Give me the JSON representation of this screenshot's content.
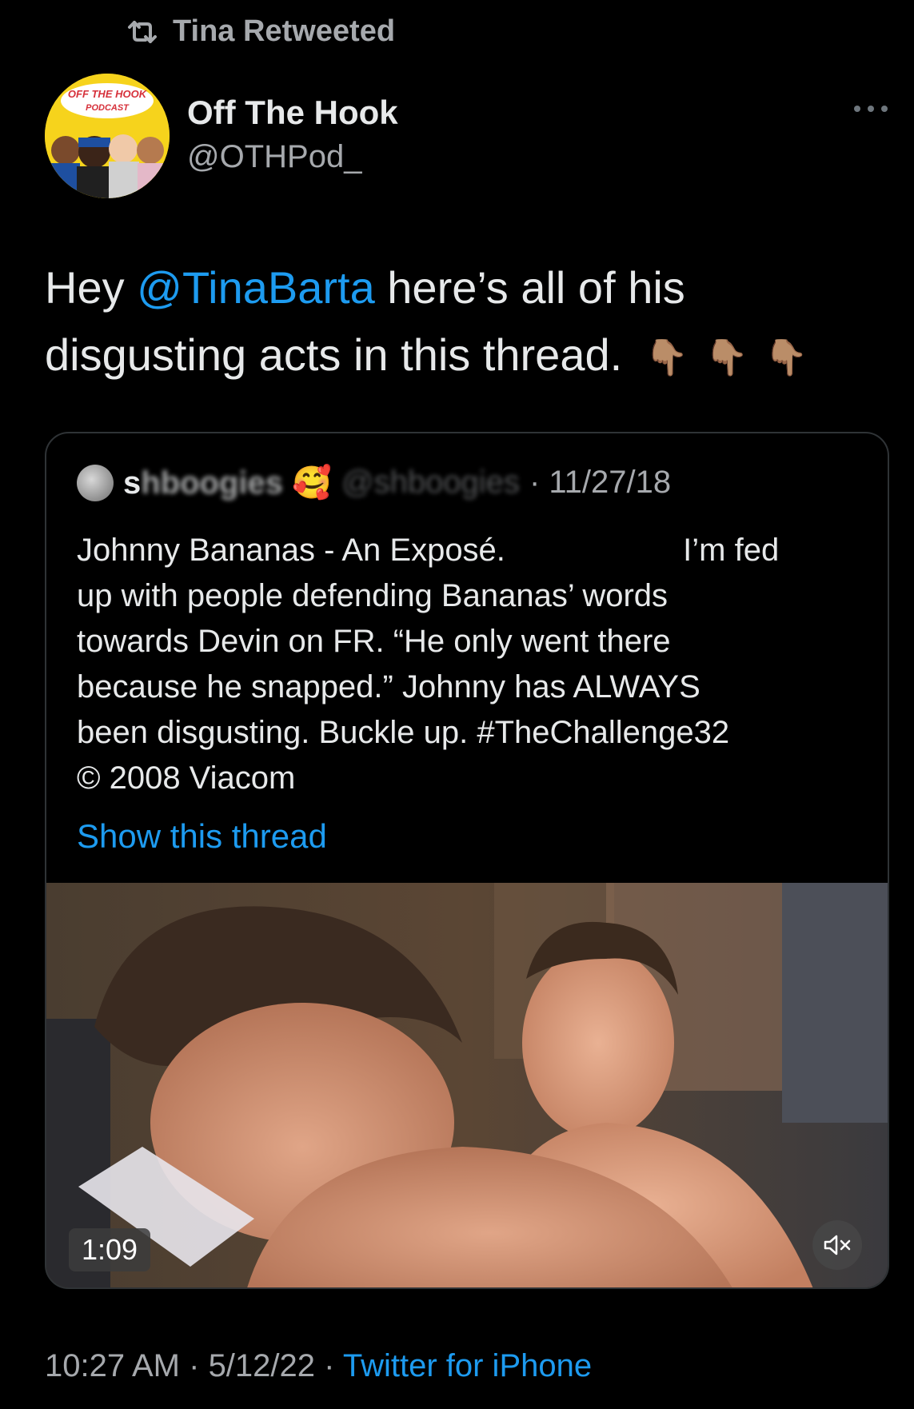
{
  "retweet_header": {
    "icon": "retweet-icon",
    "label": "Tina Retweeted"
  },
  "author": {
    "avatar_icon": "podcast-avatar",
    "avatar_text": "OFF THE HOOK PODCAST",
    "name": "Off The Hook",
    "handle": "@OTHPod_",
    "more_icon": "more-icon"
  },
  "tweet": {
    "text_before_mention": "Hey ",
    "mention": "@TinaBarta",
    "text_after_mention": " here’s all of his disgusting acts in this thread.",
    "emoji": [
      "👇🏽",
      "👇🏽",
      "👇🏽"
    ]
  },
  "quote": {
    "avatar_icon": "quoted-user-avatar",
    "name_visible_start": "s",
    "name_blurred": "hboogies",
    "name_emoji": "🥰",
    "handle_blurred": "@shboogies",
    "date": "· 11/27/18",
    "text_lines": [
      "Johnny Bananas - An Exposé.                    I’m fed",
      "up with people defending Bananas’ words",
      "towards Devin on FR. “He only went there",
      "because he snapped.” Johnny has ALWAYS",
      "been disgusting. Buckle up. #TheChallenge32",
      "© 2008 Viacom"
    ],
    "show_thread": "Show this thread",
    "video": {
      "duration": "1:09",
      "mute_icon": "muted-speaker-icon"
    }
  },
  "footer": {
    "time": "10:27 AM",
    "date": "5/12/22",
    "separator": " · ",
    "source": "Twitter for iPhone"
  },
  "colors": {
    "background": "#000000",
    "text": "#e7e9ea",
    "secondary": "#a6a9ad",
    "link": "#1d9bf0",
    "border": "#2f3336"
  }
}
